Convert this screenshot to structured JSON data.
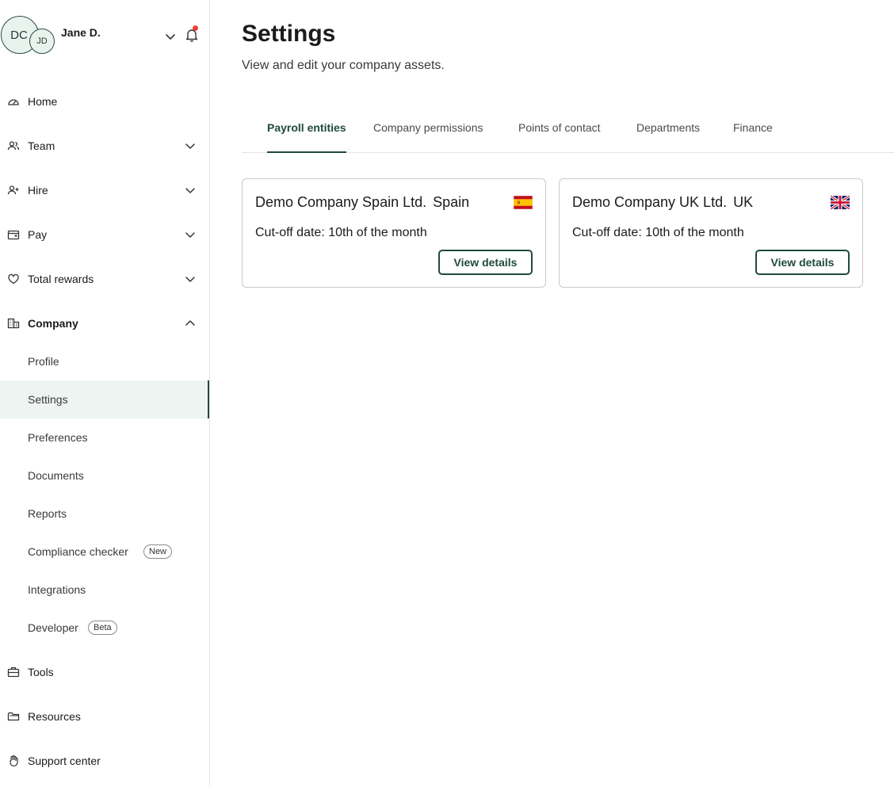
{
  "user": {
    "company_initials": "DC",
    "initials": "JD",
    "name": "Jane D."
  },
  "sidebar": {
    "items": [
      {
        "label": "Home",
        "icon": "gauge-icon",
        "expandable": false
      },
      {
        "label": "Team",
        "icon": "users-icon",
        "expandable": true
      },
      {
        "label": "Hire",
        "icon": "user-plus-icon",
        "expandable": true
      },
      {
        "label": "Pay",
        "icon": "wallet-icon",
        "expandable": true
      },
      {
        "label": "Total rewards",
        "icon": "heart-icon",
        "expandable": true
      },
      {
        "label": "Company",
        "icon": "building-icon",
        "expandable": true,
        "expanded": true
      }
    ],
    "company_subitems": [
      {
        "label": "Profile"
      },
      {
        "label": "Settings",
        "active": true
      },
      {
        "label": "Preferences"
      },
      {
        "label": "Documents"
      },
      {
        "label": "Reports"
      },
      {
        "label": "Compliance checker",
        "badge": "New"
      },
      {
        "label": "Integrations"
      },
      {
        "label": "Developer",
        "badge": "Beta"
      }
    ],
    "bottom_items": [
      {
        "label": "Tools",
        "icon": "briefcase-icon"
      },
      {
        "label": "Resources",
        "icon": "folder-icon"
      },
      {
        "label": "Support center",
        "icon": "hand-icon"
      }
    ]
  },
  "page": {
    "title": "Settings",
    "subtitle": "View and edit your company assets."
  },
  "tabs": [
    {
      "label": "Payroll entities",
      "active": true
    },
    {
      "label": "Company permissions"
    },
    {
      "label": "Points of contact"
    },
    {
      "label": "Departments"
    },
    {
      "label": "Finance"
    }
  ],
  "entities": [
    {
      "name": "Demo Company Spain Ltd.",
      "country": "Spain",
      "flag": "spain-flag-icon",
      "cutoff": "Cut-off date: 10th of the month",
      "button": "View details"
    },
    {
      "name": "Demo Company UK Ltd.",
      "country": "UK",
      "flag": "uk-flag-icon",
      "cutoff": "Cut-off date: 10th of the month",
      "button": "View details"
    }
  ],
  "colors": {
    "brand": "#1f4a3d",
    "active_bg": "#eef4f1",
    "notification": "#e8453c"
  }
}
